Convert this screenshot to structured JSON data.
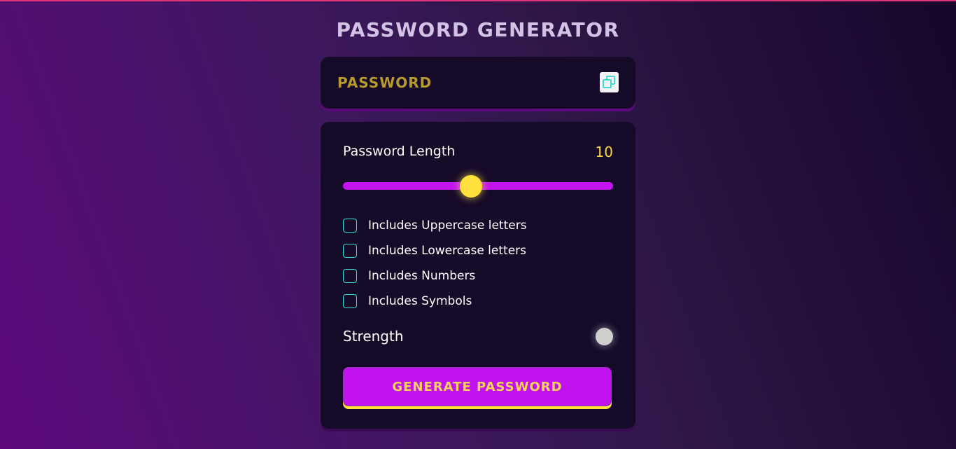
{
  "app": {
    "title": "PASSWORD GENERATOR"
  },
  "display": {
    "password_text": "PASSWORD",
    "copy_icon": "copy-icon"
  },
  "length": {
    "label": "Password Length",
    "value": "10",
    "slider_fraction": 0.475
  },
  "options": [
    {
      "label": "Includes Uppercase letters",
      "checked": false
    },
    {
      "label": "Includes Lowercase letters",
      "checked": false
    },
    {
      "label": "Includes Numbers",
      "checked": false
    },
    {
      "label": "Includes Symbols",
      "checked": false
    }
  ],
  "strength": {
    "label": "Strength",
    "indicator_color": "#cfcfcf"
  },
  "generate_button": {
    "label": "GENERATE PASSWORD"
  },
  "colors": {
    "accent_purple": "#c013f0",
    "accent_yellow": "#ffe03c",
    "checkbox_border": "#2fe0d8",
    "card_bg": "#160a29"
  }
}
